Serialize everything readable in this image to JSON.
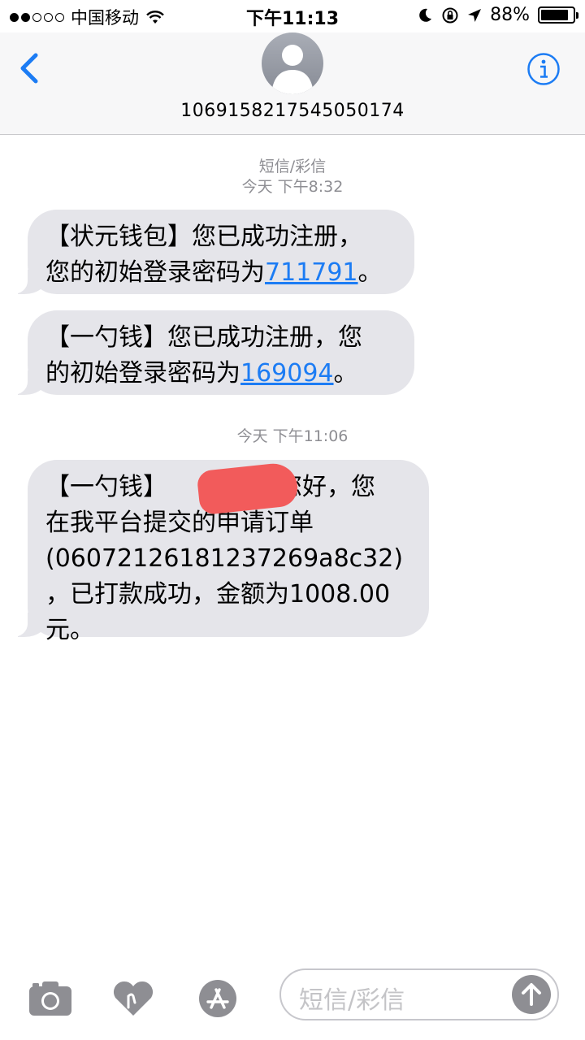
{
  "status": {
    "carrier": "中国移动",
    "time": "下午11:13",
    "battery": "88%"
  },
  "header": {
    "contact": "1069158217545050174"
  },
  "thread": {
    "service_label": "短信/彩信",
    "messages": [
      {
        "timestamp": "今天 下午8:32",
        "line1": "【状元钱包】您已成功注册，",
        "line2_prefix": "您的初始登录密码为",
        "code": "711791",
        "line2_suffix": "。"
      },
      {
        "line1": "【一勺钱】您已成功注册，您",
        "line2_prefix": "的初始登录密码为",
        "code": "169094",
        "line2_suffix": "。"
      },
      {
        "timestamp": "今天 下午11:06",
        "line1_a": "【一勺钱】",
        "line1_b": "您好，您",
        "line2": "在我平台提交的申请订单",
        "line3": "(06072126181237269a8c32)",
        "line4": "，已打款成功，金额为1008.00",
        "line5": "元。"
      }
    ]
  },
  "input": {
    "placeholder": "短信/彩信"
  },
  "colors": {
    "accent": "#1c7cf4",
    "bubble": "#e5e5ea",
    "redaction": "#f25b5b"
  },
  "icons": [
    "camera-icon",
    "digital-touch-icon",
    "app-store-icon",
    "send-arrow-icon",
    "back-chevron-icon",
    "info-icon",
    "moon-icon",
    "orientation-lock-icon",
    "location-arrow-icon",
    "wifi-icon"
  ]
}
